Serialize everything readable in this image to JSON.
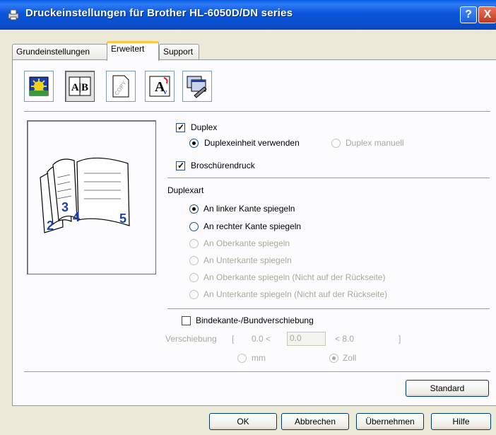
{
  "window": {
    "title": "Druckeinstellungen für Brother HL-6050D/DN series",
    "help_button": "?",
    "close_button": "X"
  },
  "tabs": [
    {
      "label": "Grundeinstellungen",
      "active": false
    },
    {
      "label": "Erweitert",
      "active": true
    },
    {
      "label": "Support",
      "active": false
    }
  ],
  "toolbar": {
    "icons": [
      "image-quality-icon",
      "duplex-icon",
      "watermark-icon",
      "scaling-icon",
      "device-options-icon"
    ],
    "watermark_text": "COPY",
    "duplex_text": "A|B"
  },
  "preview": {
    "page_numbers": [
      "2",
      "3",
      "4",
      "5"
    ]
  },
  "duplex": {
    "label": "Duplex",
    "checked": true,
    "options": [
      {
        "label": "Duplexeinheit verwenden",
        "selected": true,
        "enabled": true
      },
      {
        "label": "Duplex manuell",
        "selected": false,
        "enabled": false
      }
    ]
  },
  "booklet": {
    "label": "Broschürendruck",
    "checked": true
  },
  "duplex_type": {
    "heading": "Duplexart",
    "options": [
      {
        "label": "An linker Kante spiegeln",
        "selected": true,
        "enabled": true
      },
      {
        "label": "An rechter Kante spiegeln",
        "selected": false,
        "enabled": true
      },
      {
        "label": "An Oberkante spiegeln",
        "selected": false,
        "enabled": false
      },
      {
        "label": "An Unterkante spiegeln",
        "selected": false,
        "enabled": false
      },
      {
        "label": "An Oberkante spiegeln (Nicht auf der Rückseite)",
        "selected": false,
        "enabled": false
      },
      {
        "label": "An Unterkante spiegeln (Nicht auf der Rückseite)",
        "selected": false,
        "enabled": false
      }
    ]
  },
  "binding_offset": {
    "label": "Bindekante-/Bundverschiebung",
    "checked": false,
    "offset_label": "Verschiebung",
    "bracket_open": "[",
    "bracket_close": "]",
    "min_text": "0.0  <",
    "value": "0.0",
    "max_text": "<    8.0",
    "units": [
      {
        "label": "mm",
        "selected": false
      },
      {
        "label": "Zoll",
        "selected": true
      }
    ]
  },
  "buttons": {
    "standard": "Standard",
    "ok": "OK",
    "cancel": "Abbrechen",
    "apply": "Übernehmen",
    "help": "Hilfe"
  }
}
